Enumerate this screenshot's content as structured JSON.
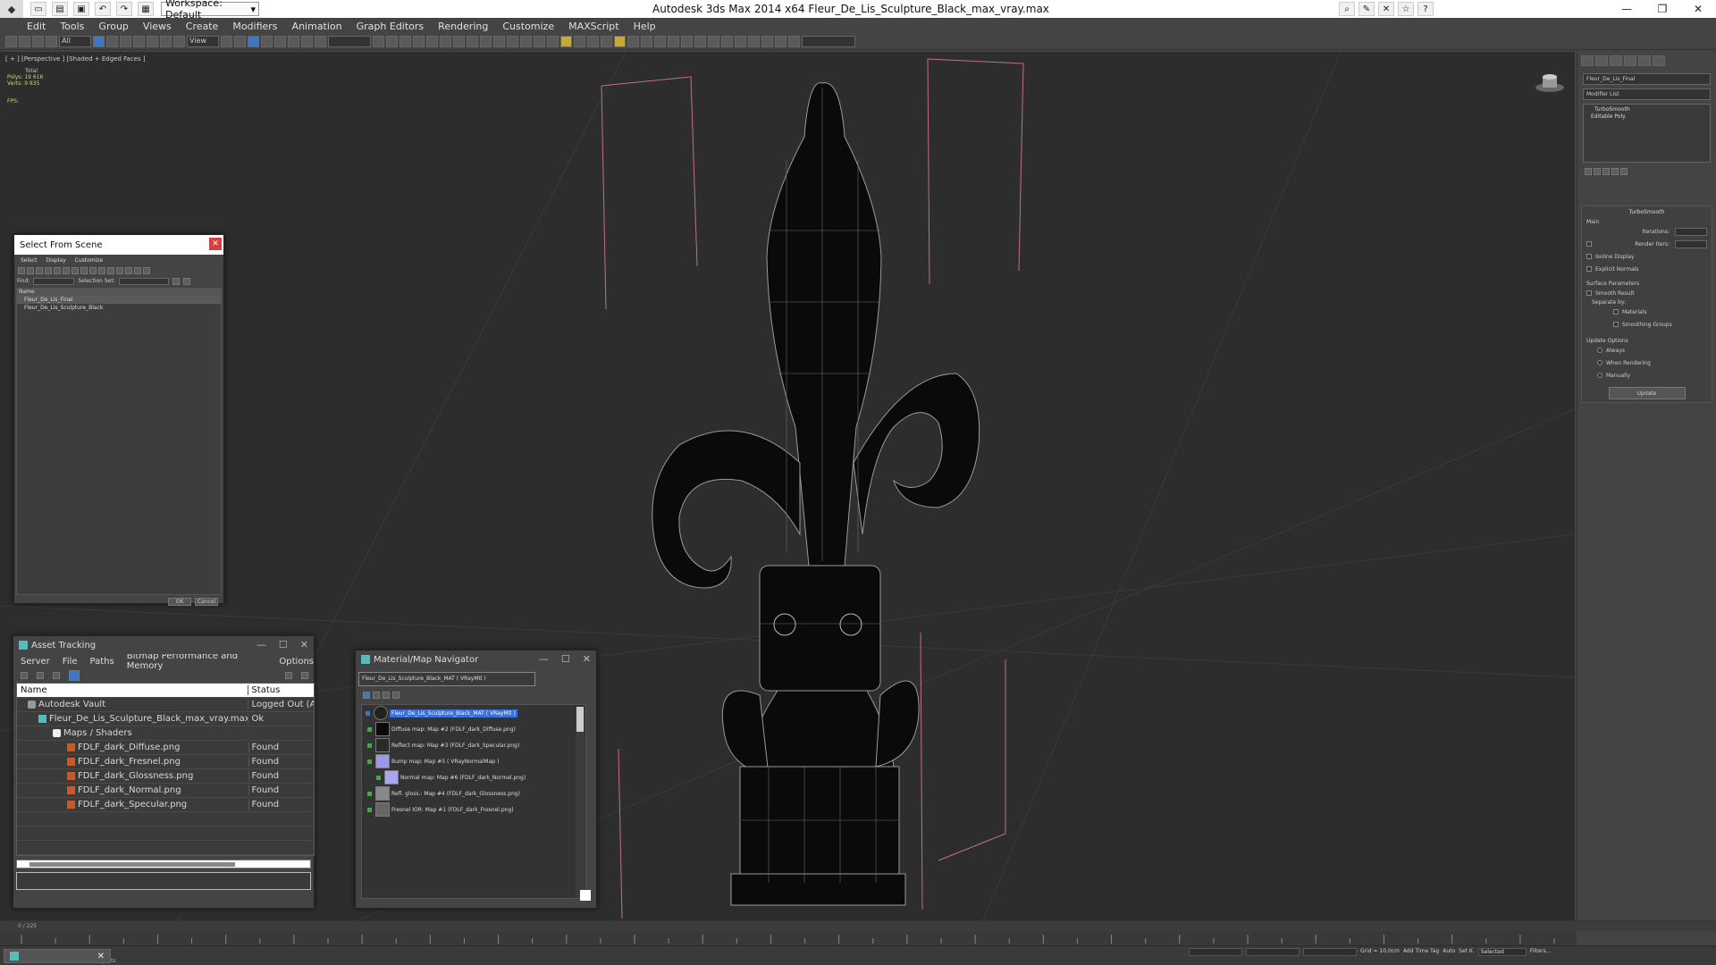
{
  "titlebar": {
    "workspace": "Workspace: Default",
    "title": "Autodesk 3ds Max  2014 x64     Fleur_De_Lis_Sculpture_Black_max_vray.max"
  },
  "menu": [
    "Edit",
    "Tools",
    "Group",
    "Views",
    "Create",
    "Modifiers",
    "Animation",
    "Graph Editors",
    "Rendering",
    "Customize",
    "MAXScript",
    "Help"
  ],
  "toolbar": {
    "selection_filter": "All",
    "ref_coord": "View"
  },
  "viewport": {
    "label": "[ + ] [Perspective ] [Shaded + Edged Faces ]",
    "stats_total": "Total",
    "stats_polys": "Polys:  19 616",
    "stats_verts": "Verts:   9 835",
    "fps": "FPS:"
  },
  "command_panel": {
    "object_name": "Fleur_De_Lis_Final",
    "modifier_list": "Modifier List",
    "stack": [
      "TurboSmooth",
      "Editable Poly"
    ],
    "turbosmooth_title": "TurboSmooth",
    "main": "Main",
    "iterations": "Iterations:",
    "render_iters": "Render Iters:",
    "isoline": "Isoline Display",
    "explicit_normals": "Explicit Normals",
    "surface_params": "Surface Parameters",
    "smooth_result": "Smooth Result",
    "separate_by": "Separate by:",
    "materials": "Materials",
    "smoothing_groups": "Smoothing Groups",
    "update_options": "Update Options",
    "always": "Always",
    "when_rendering": "When Rendering",
    "manually": "Manually",
    "update": "Update"
  },
  "select_from_scene": {
    "title": "Select From Scene",
    "menu": [
      "Select",
      "Display",
      "Customize"
    ],
    "find_label": "Find:",
    "selection_set": "Selection Set:",
    "col_name": "Name",
    "items": [
      "Fleur_De_Lis_Final",
      "Fleur_De_Lis_Sculpture_Black"
    ],
    "ok": "OK",
    "cancel": "Cancel"
  },
  "asset_tracking": {
    "title": "Asset Tracking",
    "menu": [
      "Server",
      "File",
      "Paths",
      "Bitmap Performance and Memory",
      "Options"
    ],
    "col_name": "Name",
    "col_status": "Status",
    "rows": [
      {
        "name": "Autodesk Vault",
        "status": "Logged Out (As"
      },
      {
        "name": "Fleur_De_Lis_Sculpture_Black_max_vray.max",
        "status": "Ok"
      },
      {
        "name": "Maps / Shaders",
        "status": ""
      },
      {
        "name": "FDLF_dark_Diffuse.png",
        "status": "Found"
      },
      {
        "name": "FDLF_dark_Fresnel.png",
        "status": "Found"
      },
      {
        "name": "FDLF_dark_Glossness.png",
        "status": "Found"
      },
      {
        "name": "FDLF_dark_Normal.png",
        "status": "Found"
      },
      {
        "name": "FDLF_dark_Specular.png",
        "status": "Found"
      }
    ]
  },
  "material_navigator": {
    "title": "Material/Map Navigator",
    "field": "Fleur_De_Lis_Sculpture_Black_MAT  ( VRayMtl )",
    "root": "Fleur_De_Lis_Sculpture_Black_MAT  ( VRayMtl )",
    "maps": [
      {
        "label": "Diffuse map: Map #2 (FDLF_dark_Diffuse.png)",
        "color": "#0a0a0a"
      },
      {
        "label": "Reflect map: Map #3 (FDLF_dark_Specular.png)",
        "color": "#2a2a2a"
      },
      {
        "label": "Bump map: Map #5  ( VRayNormalMap )",
        "color": "#9a9ae8"
      },
      {
        "label": "Normal map: Map #6 (FDLF_dark_Normal.png)",
        "color": "#a8a8f0"
      },
      {
        "label": "Refl. gloss.: Map #4 (FDLF_dark_Glossness.png)",
        "color": "#888888"
      },
      {
        "label": "Fresnel IOR: Map #1 (FDLF_dark_Fresnel.png)",
        "color": "#666666"
      }
    ]
  },
  "timeline": {
    "frame": "0 / 225"
  },
  "status": {
    "objects": "objects",
    "grid": "Grid = 10,0cm",
    "auto": "Auto",
    "selected": "Selected",
    "set_k": "Set K.",
    "filters": "Filters...",
    "add_time_tag": "Add Time Tag"
  }
}
